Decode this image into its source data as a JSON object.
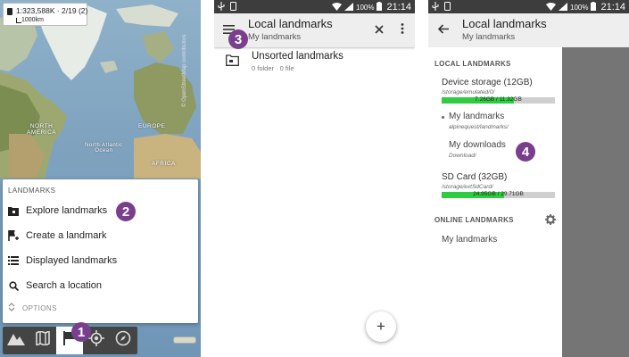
{
  "colors": {
    "badge": "#7a3f8c",
    "statusbar": "#3d3d3d",
    "appbar": "#eeeeee",
    "storage_fill": "#2ecc40",
    "scrim": "#757575"
  },
  "panel1": {
    "scale": {
      "text": "1:323,588K · 2/19 (2)",
      "distance": "1000km"
    },
    "map_labels": {
      "north_america": "NORTH\nAMERICA",
      "europe": "EUROPE",
      "africa": "AFRICA",
      "north_atlantic": "North Atlantic\nOcean"
    },
    "map_credit": "© OpenStreetMap contributors",
    "menu": {
      "heading": "LANDMARKS",
      "items": [
        {
          "label": "Explore landmarks",
          "icon": "folder-landmark-icon"
        },
        {
          "label": "Create a landmark",
          "icon": "flag-add-icon"
        },
        {
          "label": "Displayed landmarks",
          "icon": "list-icon"
        },
        {
          "label": "Search a location",
          "icon": "search-icon"
        }
      ],
      "options_label": "OPTIONS"
    },
    "badges": {
      "explore": "2",
      "toolbar": "1"
    },
    "toolbar": [
      {
        "icon": "mountain-icon"
      },
      {
        "icon": "map-icon"
      },
      {
        "icon": "flag-icon",
        "active": true
      },
      {
        "icon": "locate-icon"
      },
      {
        "icon": "compass-icon"
      }
    ]
  },
  "status": {
    "battery": "100%",
    "time": "21:14"
  },
  "panel2": {
    "title": "Local landmarks",
    "subtitle": "My landmarks",
    "badge": "3",
    "folder": {
      "title": "Unsorted landmarks",
      "subtitle": "0 folder · 0 file"
    },
    "fab_label": "+"
  },
  "panel3": {
    "title": "Local landmarks",
    "subtitle": "My landmarks",
    "local_heading": "LOCAL LANDMARKS",
    "device_storage": {
      "title": "Device storage (12GB)",
      "path": "/storage/emulated/0/",
      "usage": "7.26GB / 11.32GB",
      "fraction": 0.64
    },
    "my_landmarks": {
      "title": "My landmarks",
      "path": "alpinequest/landmarks/"
    },
    "my_downloads": {
      "title": "My downloads",
      "path": "Download/"
    },
    "badge": "4",
    "sd_card": {
      "title": "SD Card (32GB)",
      "path": "/storage/extSdCard/",
      "usage": "24.95GB / 29.71GB",
      "fraction": 0.55
    },
    "online_heading": "ONLINE LANDMARKS",
    "online_item": "My landmarks"
  }
}
